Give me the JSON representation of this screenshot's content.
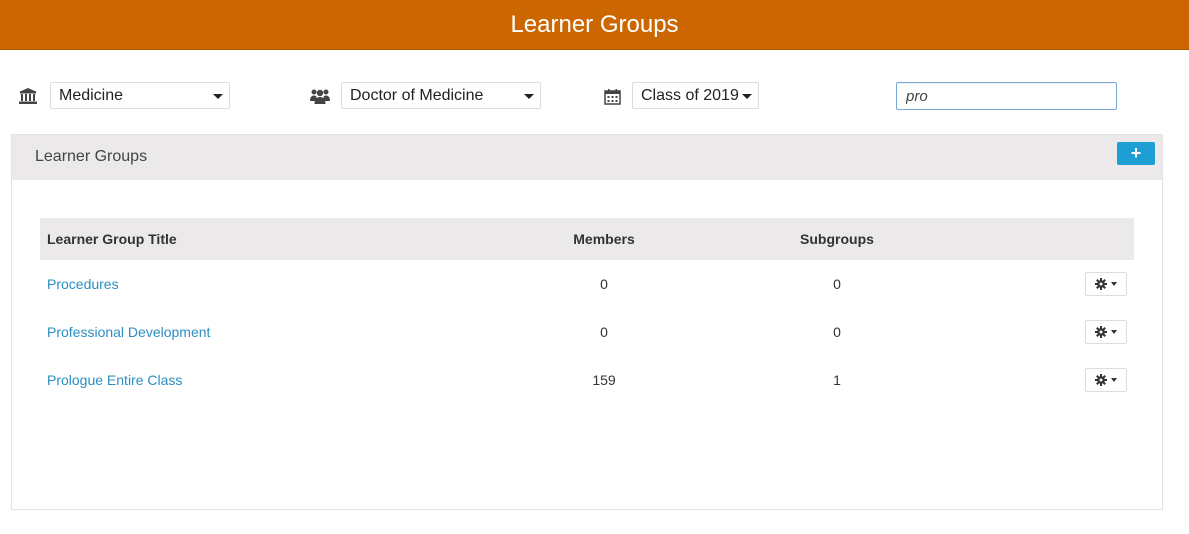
{
  "header": {
    "title": "Learner Groups"
  },
  "filters": {
    "school": {
      "icon": "institution-icon",
      "value": "Medicine"
    },
    "program": {
      "icon": "users-icon",
      "value": "Doctor of Medicine"
    },
    "cohort": {
      "icon": "calendar-icon",
      "value": "Class of 2019"
    },
    "search": {
      "value": "pro",
      "placeholder": ""
    }
  },
  "panel": {
    "title": "Learner Groups",
    "add_label": "+",
    "columns": [
      "Learner Group Title",
      "Members",
      "Subgroups"
    ],
    "rows": [
      {
        "title": "Procedures",
        "members": "0",
        "subgroups": "0"
      },
      {
        "title": "Professional Development",
        "members": "0",
        "subgroups": "0"
      },
      {
        "title": "Prologue Entire Class",
        "members": "159",
        "subgroups": "1"
      }
    ]
  },
  "colors": {
    "header_bg": "#cc6600",
    "link": "#2b8fc2",
    "add_button": "#1e9fd4",
    "panel_header_bg": "#ebe9e9"
  }
}
